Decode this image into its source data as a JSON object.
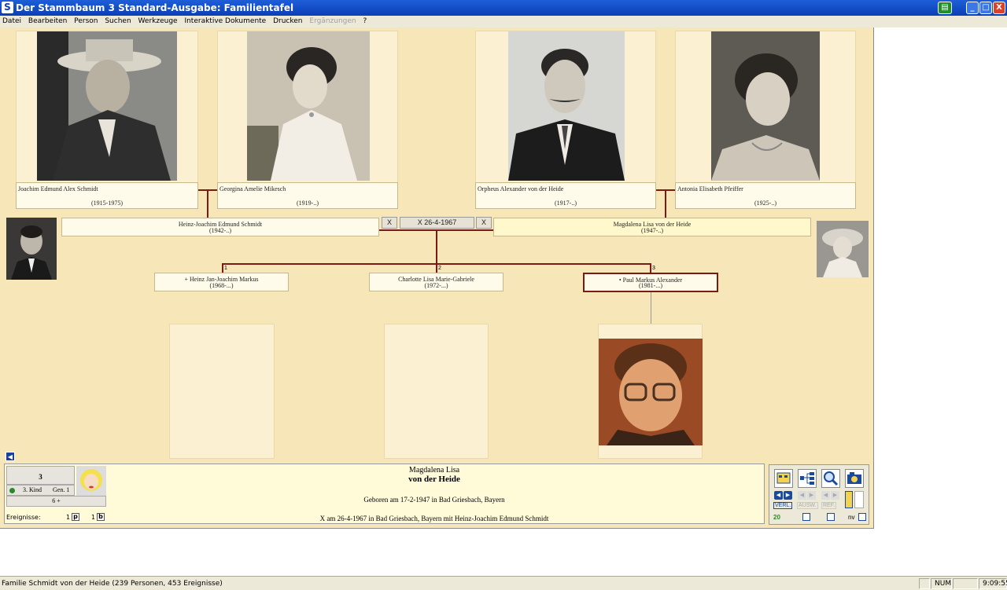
{
  "window": {
    "title": "Der Stammbaum 3 Standard-Ausgabe: Familientafel",
    "app_icon": "S",
    "min": "_",
    "max": "□",
    "close": "X"
  },
  "menu": [
    {
      "label": "Datei",
      "enabled": true
    },
    {
      "label": "Bearbeiten",
      "enabled": true
    },
    {
      "label": "Person",
      "enabled": true
    },
    {
      "label": "Suchen",
      "enabled": true
    },
    {
      "label": "Werkzeuge",
      "enabled": true
    },
    {
      "label": "Interaktive Dokumente",
      "enabled": true
    },
    {
      "label": "Drucken",
      "enabled": true
    },
    {
      "label": "Ergänzungen",
      "enabled": false
    },
    {
      "label": "?",
      "enabled": true
    }
  ],
  "grandparents": [
    {
      "name": "Joachim Edmund Alex Schmidt",
      "dates": "(1915-1975)"
    },
    {
      "name": "Georgina Amelie Mikesch",
      "dates": "(1919-..)"
    },
    {
      "name": "Orpheus Alexander von der Heide",
      "dates": "(1917-..)"
    },
    {
      "name": "Antonia Elisabeth Pfeiffer",
      "dates": "(1925-..)"
    }
  ],
  "parents": {
    "father": {
      "name": "Heinz-Joachim Edmund Schmidt",
      "dates": "(1942-..)"
    },
    "mother": {
      "name": "Magdalena Lisa von der Heide",
      "dates": "(1947-..)"
    },
    "marriage": {
      "left_x": "X",
      "label": "X 26-4-1967",
      "right_x": "X"
    }
  },
  "children": [
    {
      "num": "1",
      "name": "+ Heinz Jan-Joachim Markus",
      "dates": "(1968-...)"
    },
    {
      "num": "2",
      "name": "Charlotte Lisa Marie-Gabriele",
      "dates": "(1972-...)"
    },
    {
      "num": "3",
      "name": "• Paul Markus Alexander",
      "dates": "(1981-...)"
    }
  ],
  "info": {
    "index": "3",
    "child_label": "3. Kind",
    "gen_label": "Gen. 1",
    "count": "6 +",
    "events_label": "Ereignisse:",
    "events_p_count": "1",
    "events_p": "p",
    "events_b_count": "1",
    "events_b": "b",
    "first_names": "Magdalena Lisa",
    "surname": "von der Heide",
    "born": "Geboren am 17-2-1947 in Bad Griesbach, Bayern",
    "married": "X am 26-4-1967 in Bad Griesbach, Bayern mit Heinz-Joachim Edmund Schmidt"
  },
  "tools": {
    "verl": "VERL.",
    "ausw": "AUSW.",
    "ref": "REF.",
    "num": "20",
    "nv": "nv"
  },
  "statusbar": {
    "text": "Familie Schmidt von der Heide (239 Personen, 453 Ereignisse)",
    "num": "NUM",
    "time": "9:09:55"
  },
  "colors": {
    "canvas": "#f7e6b8",
    "line": "#7a1a14",
    "titlebar": "#0a3fb6"
  }
}
